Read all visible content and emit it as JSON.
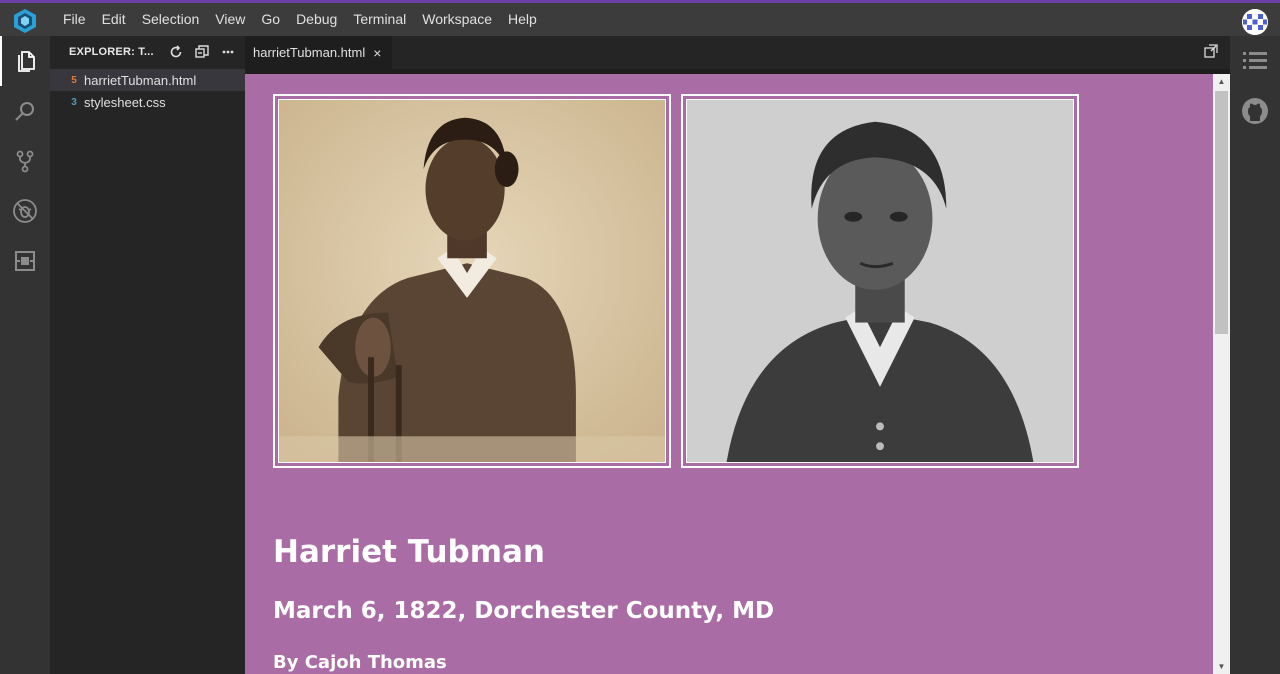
{
  "menubar": {
    "items": [
      "File",
      "Edit",
      "Selection",
      "View",
      "Go",
      "Debug",
      "Terminal",
      "Workspace",
      "Help"
    ]
  },
  "sidebar": {
    "title": "EXPLORER: T...",
    "files": [
      {
        "name": "harrietTubman.html",
        "icon": "html-file-icon",
        "icon_glyph": "5",
        "icon_color": "#e37933",
        "selected": true
      },
      {
        "name": "stylesheet.css",
        "icon": "css-file-icon",
        "icon_glyph": "3",
        "icon_color": "#519aba",
        "selected": false
      }
    ]
  },
  "editor": {
    "tab_label": "harrietTubman.html",
    "tab_close": "×"
  },
  "preview": {
    "background": "#a96ca4",
    "heading": "Harriet Tubman",
    "subheading": "March 6, 1822, Dorchester County, MD",
    "byline": "By Cajoh Thomas"
  },
  "colors": {
    "accent": "#6c3fa3",
    "activity_bar": "#333333",
    "sidebar": "#252526",
    "editor": "#1e1e1e"
  }
}
